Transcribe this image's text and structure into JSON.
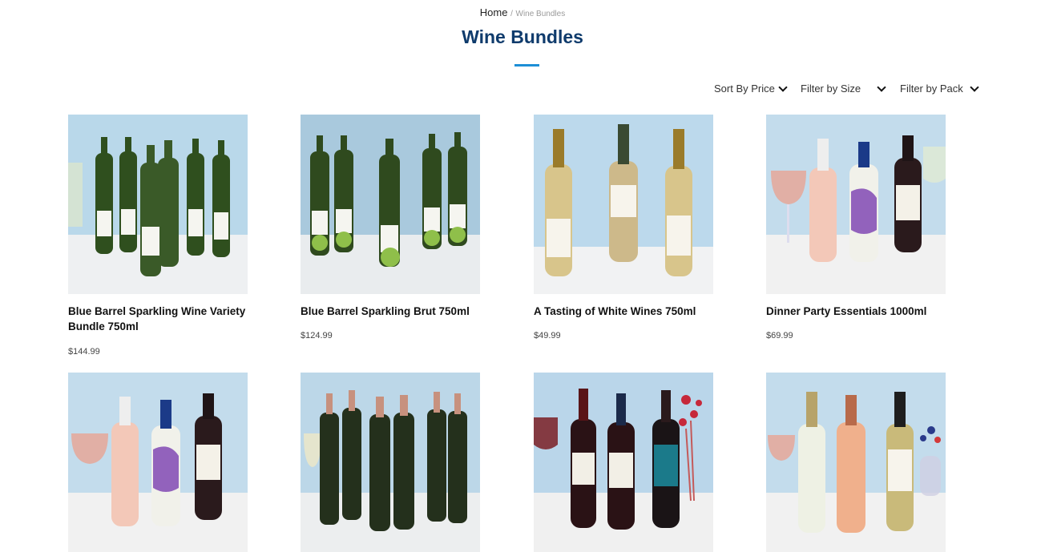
{
  "breadcrumb": {
    "home": "Home",
    "separator": "/",
    "current": "Wine Bundles"
  },
  "page": {
    "title": "Wine Bundles"
  },
  "filters": {
    "sort_price": "Sort By Price",
    "filter_size": "Filter by Size",
    "filter_pack": "Filter by Pack"
  },
  "products": [
    {
      "name": "Blue Barrel Sparkling Wine Variety Bundle 750ml",
      "price": "$144.99"
    },
    {
      "name": "Blue Barrel Sparkling Brut 750ml",
      "price": "$124.99"
    },
    {
      "name": "A Tasting of White Wines 750ml",
      "price": "$49.99"
    },
    {
      "name": "Dinner Party Essentials 1000ml",
      "price": "$69.99"
    },
    {
      "name": "",
      "price": ""
    },
    {
      "name": "",
      "price": ""
    },
    {
      "name": "",
      "price": ""
    },
    {
      "name": "",
      "price": ""
    }
  ],
  "colors": {
    "title": "#0f3b6c",
    "accent": "#1d8fd6",
    "photo_bg": "#b9d8ea"
  }
}
